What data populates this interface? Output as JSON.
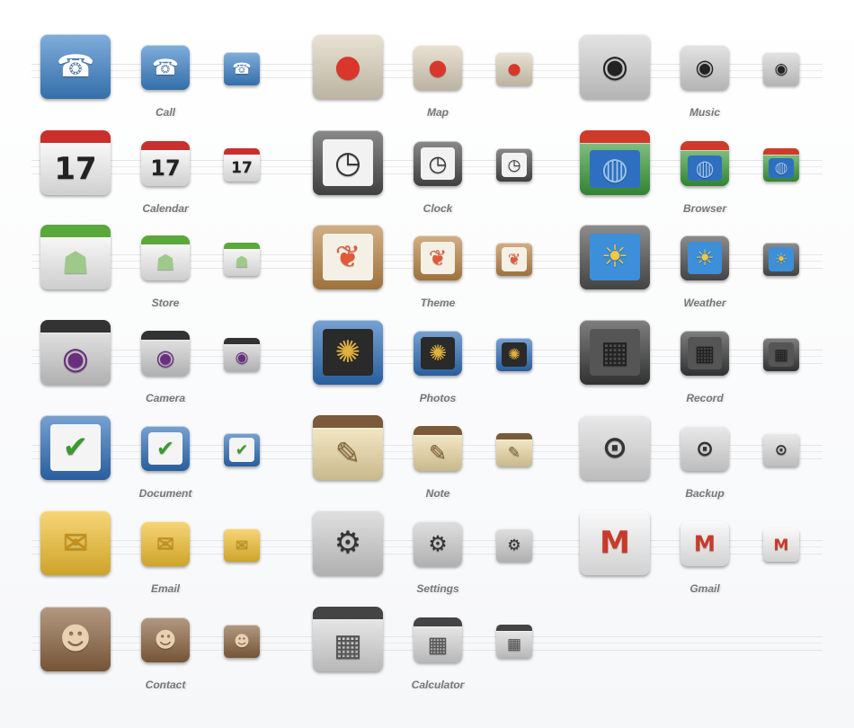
{
  "icons": [
    {
      "label": "Call",
      "icon": "phone-icon",
      "bg": "#3d82c8",
      "screen": "",
      "glyph": "☎",
      "fg": "#ffffff"
    },
    {
      "label": "Map",
      "icon": "map-pin-icon",
      "bg": "#ddd3bd",
      "screen": "",
      "glyph": "●",
      "fg": "#d9362c"
    },
    {
      "label": "Music",
      "icon": "turntable-icon",
      "bg": "#d4d4d4",
      "screen": "",
      "glyph": "◉",
      "fg": "#222222"
    },
    {
      "label": "Calendar",
      "icon": "calendar-icon",
      "bg": "#f4f4f4",
      "screen": "",
      "glyph": "17",
      "fg": "#222222",
      "top": "#c9302c"
    },
    {
      "label": "Clock",
      "icon": "clock-icon",
      "bg": "#4a4a4a",
      "screen": "#f2f2f2",
      "glyph": "◷",
      "fg": "#333333"
    },
    {
      "label": "Browser",
      "icon": "globe-icon",
      "bg": "#3b9a3b",
      "screen": "#2f6fc0",
      "glyph": "◍",
      "fg": "#9cc4ee",
      "top": "#d03a2a"
    },
    {
      "label": "Store",
      "icon": "shopping-bag-icon",
      "bg": "#f2f2f2",
      "screen": "",
      "glyph": "☗",
      "fg": "#9ec98a",
      "top": "#5aa83a"
    },
    {
      "label": "Theme",
      "icon": "palette-icon",
      "bg": "#b98546",
      "screen": "#f5f0e6",
      "glyph": "❦",
      "fg": "#e05a3a"
    },
    {
      "label": "Weather",
      "icon": "weather-icon",
      "bg": "#4f4f4f",
      "screen": "#3c8fd8",
      "glyph": "☀",
      "fg": "#f5c842"
    },
    {
      "label": "Camera",
      "icon": "camera-icon",
      "bg": "#cfcfcf",
      "screen": "",
      "glyph": "◉",
      "fg": "#6a2d80",
      "top": "#333333"
    },
    {
      "label": "Photos",
      "icon": "photo-icon",
      "bg": "#2f6fb8",
      "screen": "#2a2a2a",
      "glyph": "✺",
      "fg": "#e0b040"
    },
    {
      "label": "Record",
      "icon": "amplifier-icon",
      "bg": "#3a3a3a",
      "screen": "#555555",
      "glyph": "▦",
      "fg": "#222222"
    },
    {
      "label": "Document",
      "icon": "document-check-icon",
      "bg": "#2f6fb8",
      "screen": "#f4f4f4",
      "glyph": "✔",
      "fg": "#3a9a30"
    },
    {
      "label": "Note",
      "icon": "notepad-icon",
      "bg": "#ecd9a4",
      "screen": "",
      "glyph": "✎",
      "fg": "#8a6a3a",
      "top": "#7a5a38"
    },
    {
      "label": "Backup",
      "icon": "safe-lock-icon",
      "bg": "#dedede",
      "screen": "",
      "glyph": "⊙",
      "fg": "#333333"
    },
    {
      "label": "Email",
      "icon": "envelope-icon",
      "bg": "#f2c030",
      "screen": "",
      "glyph": "✉",
      "fg": "#c8901a"
    },
    {
      "label": "Settings",
      "icon": "settings-panel-icon",
      "bg": "#cfcfcf",
      "screen": "",
      "glyph": "⚙",
      "fg": "#333333"
    },
    {
      "label": "Gmail",
      "icon": "gmail-icon",
      "bg": "#f6f6f6",
      "screen": "",
      "glyph": "M",
      "fg": "#c93a2a"
    },
    {
      "label": "Contact",
      "icon": "contact-book-icon",
      "bg": "#8a6340",
      "screen": "",
      "glyph": "☻",
      "fg": "#e8d0b0"
    },
    {
      "label": "Calculator",
      "icon": "calculator-icon",
      "bg": "#d8d8d8",
      "screen": "",
      "glyph": "▦",
      "fg": "#555555",
      "top": "#444444"
    }
  ]
}
